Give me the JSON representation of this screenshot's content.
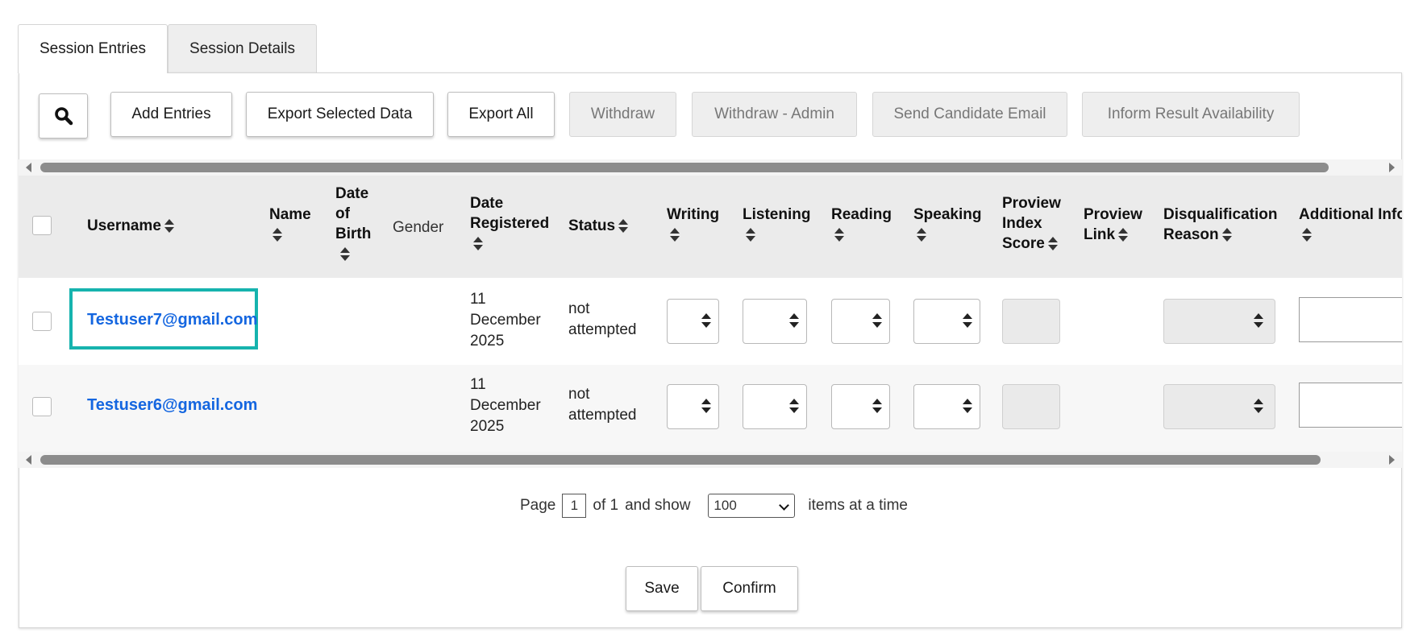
{
  "tabs": [
    {
      "label": "Session Entries",
      "active": true
    },
    {
      "label": "Session Details",
      "active": false
    }
  ],
  "toolbar": {
    "search_icon": "search-icon",
    "buttons": [
      {
        "label": "Add Entries",
        "enabled": true
      },
      {
        "label": "Export Selected Data",
        "enabled": true
      },
      {
        "label": "Export All",
        "enabled": true
      },
      {
        "label": "Withdraw",
        "enabled": false
      },
      {
        "label": "Withdraw - Admin",
        "enabled": false
      },
      {
        "label": "Send Candidate Email",
        "enabled": false
      },
      {
        "label": "Inform Result Availability",
        "enabled": false
      }
    ]
  },
  "table": {
    "columns": [
      {
        "label": "Username",
        "sortable": true
      },
      {
        "label": "Name",
        "sortable": true
      },
      {
        "label": "Date of Birth",
        "sortable": true
      },
      {
        "label": "Gender",
        "sortable": false
      },
      {
        "label": "Date Registered",
        "sortable": true
      },
      {
        "label": "Status",
        "sortable": true
      },
      {
        "label": "Writing",
        "sortable": true
      },
      {
        "label": "Listening",
        "sortable": true
      },
      {
        "label": "Reading",
        "sortable": true
      },
      {
        "label": "Speaking",
        "sortable": true
      },
      {
        "label": "Proview Index Score",
        "sortable": true
      },
      {
        "label": "Proview Link",
        "sortable": true
      },
      {
        "label": "Disqualification Reason",
        "sortable": true
      },
      {
        "label": "Additional Info",
        "sortable": true
      }
    ],
    "rows": [
      {
        "username": "Testuser7@gmail.com",
        "name": "",
        "dob": "",
        "gender": "",
        "date_registered": [
          "11",
          "December",
          "2025"
        ],
        "status": [
          "not",
          "attempted"
        ],
        "writing": "",
        "listening": "",
        "reading": "",
        "speaking": "",
        "proview_score": "",
        "proview_link": "",
        "disqualification": "",
        "additional_info": "",
        "highlighted": true
      },
      {
        "username": "Testuser6@gmail.com",
        "name": "",
        "dob": "",
        "gender": "",
        "date_registered": [
          "11",
          "December",
          "2025"
        ],
        "status": [
          "not",
          "attempted"
        ],
        "writing": "",
        "listening": "",
        "reading": "",
        "speaking": "",
        "proview_score": "",
        "proview_link": "",
        "disqualification": "",
        "additional_info": "",
        "highlighted": false
      }
    ]
  },
  "pagination": {
    "page_label": "Page",
    "current_page": "1",
    "of_label": "of 1",
    "and_show_label": "and show",
    "page_size": "100",
    "items_label": "items at a time"
  },
  "footer": {
    "save_label": "Save",
    "confirm_label": "Confirm"
  },
  "colors": {
    "link": "#1466e0",
    "highlight_border": "#16b3ae",
    "header_bg": "#ebebeb",
    "disabled_bg": "#eeeeee"
  }
}
